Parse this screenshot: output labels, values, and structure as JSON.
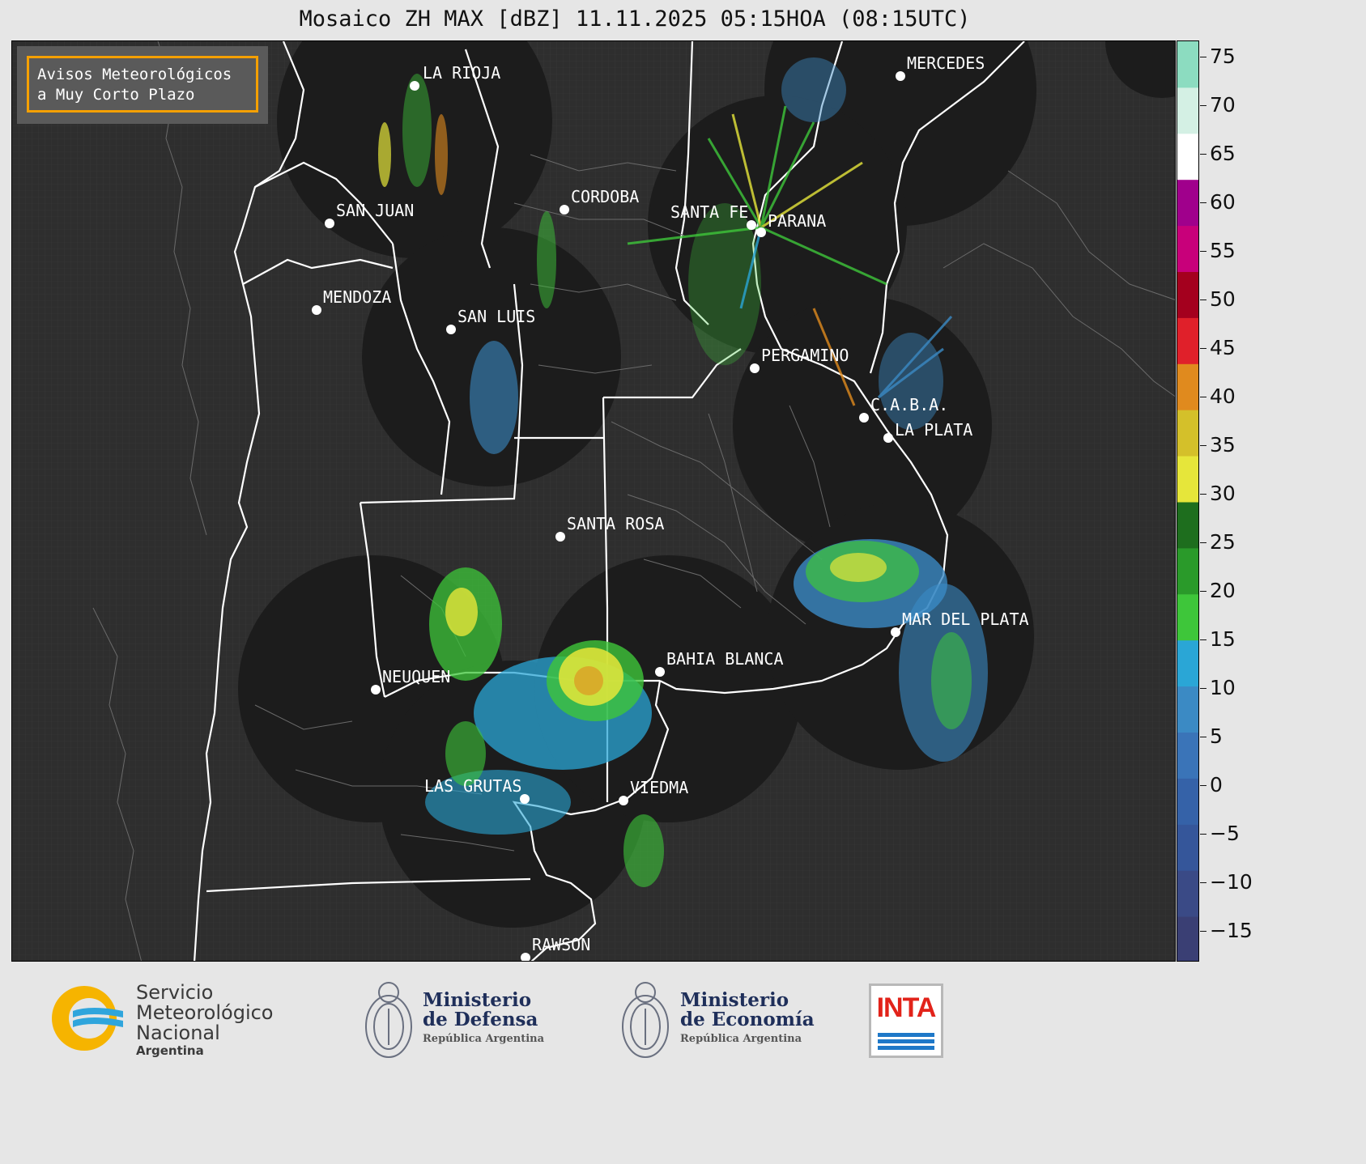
{
  "title": "Mosaico ZH MAX [dBZ] 11.11.2025 05:15HOA (08:15UTC)",
  "badge": {
    "line1": "Avisos Meteorológicos",
    "line2": "a Muy Corto Plazo"
  },
  "colorbar": {
    "ticks": [
      "75",
      "70",
      "65",
      "60",
      "55",
      "50",
      "45",
      "40",
      "35",
      "30",
      "25",
      "20",
      "15",
      "10",
      "5",
      "0",
      "−5",
      "−10",
      "−15"
    ],
    "colors": [
      "#3a3f74",
      "#3a4a86",
      "#35569a",
      "#3562a8",
      "#3a74b8",
      "#3b8ac4",
      "#2aa6d6",
      "#3ec63a",
      "#2a9a2a",
      "#1e6e1e",
      "#e6e63a",
      "#d4c02a",
      "#e08a1e",
      "#e0202a",
      "#a4001e",
      "#c8007a",
      "#a0008c",
      "#ffffff",
      "#d4f0e4",
      "#8cdcc0"
    ]
  },
  "cities": [
    {
      "name": "LA RIOJA"
    },
    {
      "name": "MERCEDES"
    },
    {
      "name": "SAN JUAN"
    },
    {
      "name": "CORDOBA"
    },
    {
      "name": "SANTA FE"
    },
    {
      "name": "PARANA"
    },
    {
      "name": "MENDOZA"
    },
    {
      "name": "SAN LUIS"
    },
    {
      "name": "PERGAMINO"
    },
    {
      "name": "C.A.B.A."
    },
    {
      "name": "LA PLATA"
    },
    {
      "name": "SANTA ROSA"
    },
    {
      "name": "MAR DEL PLATA"
    },
    {
      "name": "BAHIA BLANCA"
    },
    {
      "name": "NEUQUEN"
    },
    {
      "name": "LAS GRUTAS"
    },
    {
      "name": "VIEDMA"
    },
    {
      "name": "RAWSON"
    }
  ],
  "footer": {
    "smn": {
      "line1": "Servicio",
      "line2": "Meteorológico",
      "line3": "Nacional",
      "line4": "Argentina"
    },
    "defensa": {
      "line1": "Ministerio",
      "line2": "de Defensa",
      "line3": "República Argentina"
    },
    "economia": {
      "line1": "Ministerio",
      "line2": "de Economía",
      "line3": "República Argentina"
    },
    "inta": {
      "label": "INTA"
    }
  }
}
